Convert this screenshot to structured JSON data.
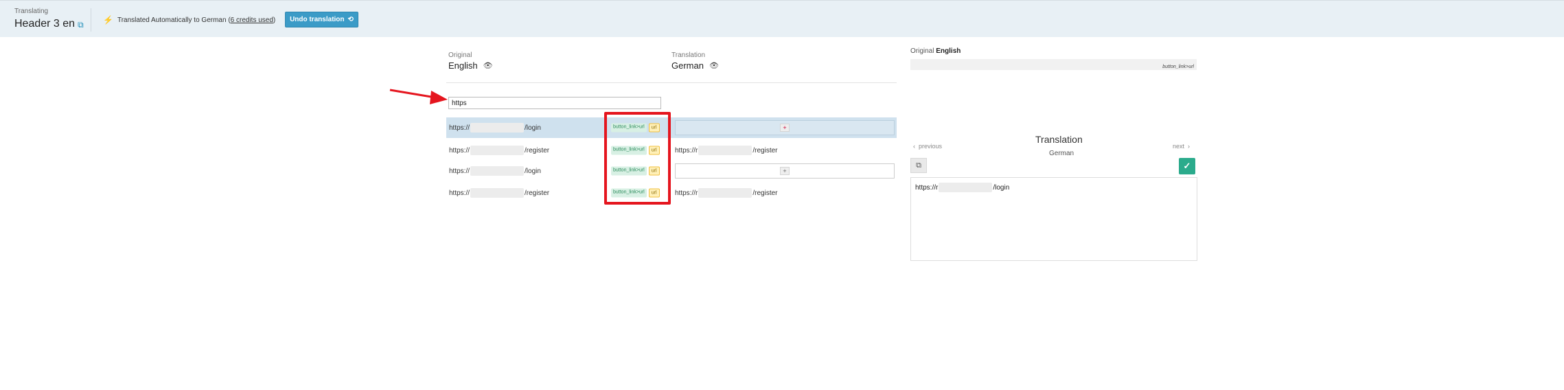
{
  "header": {
    "translating_label": "Translating",
    "title": "Header 3 en",
    "auto_text_prefix": "Translated Automatically to German (",
    "credits_text": "6 credits used",
    "auto_text_suffix": ")",
    "undo_label": "Undo translation"
  },
  "columns": {
    "original_label": "Original",
    "original_lang": "English",
    "translation_label": "Translation",
    "translation_lang": "German"
  },
  "search": {
    "value": "https"
  },
  "rows": [
    {
      "orig_prefix": "https://",
      "orig_suffix": "/login",
      "key": "button_link>url",
      "type": "url",
      "trans_prefix": "",
      "trans_suffix": ""
    },
    {
      "orig_prefix": "https://",
      "orig_suffix": "/register",
      "key": "button_link>url",
      "type": "url",
      "trans_prefix": "https://r",
      "trans_suffix": "/register"
    },
    {
      "orig_prefix": "https://",
      "orig_suffix": "/login",
      "key": "button_link>url",
      "type": "url",
      "trans_prefix": "",
      "trans_suffix": ""
    },
    {
      "orig_prefix": "https://",
      "orig_suffix": "/register",
      "key": "button_link>url",
      "type": "url",
      "trans_prefix": "https://r",
      "trans_suffix": "/register"
    }
  ],
  "right_panel": {
    "original_label": "Original",
    "original_lang": "English",
    "key": "button_link>url",
    "previous": "previous",
    "next": "next",
    "title": "Translation",
    "lang": "German",
    "text_prefix": "https://r",
    "text_suffix": "/login"
  },
  "colors": {
    "accent": "#3b9bc7",
    "highlight": "#e5151e",
    "save": "#2bab8c"
  }
}
